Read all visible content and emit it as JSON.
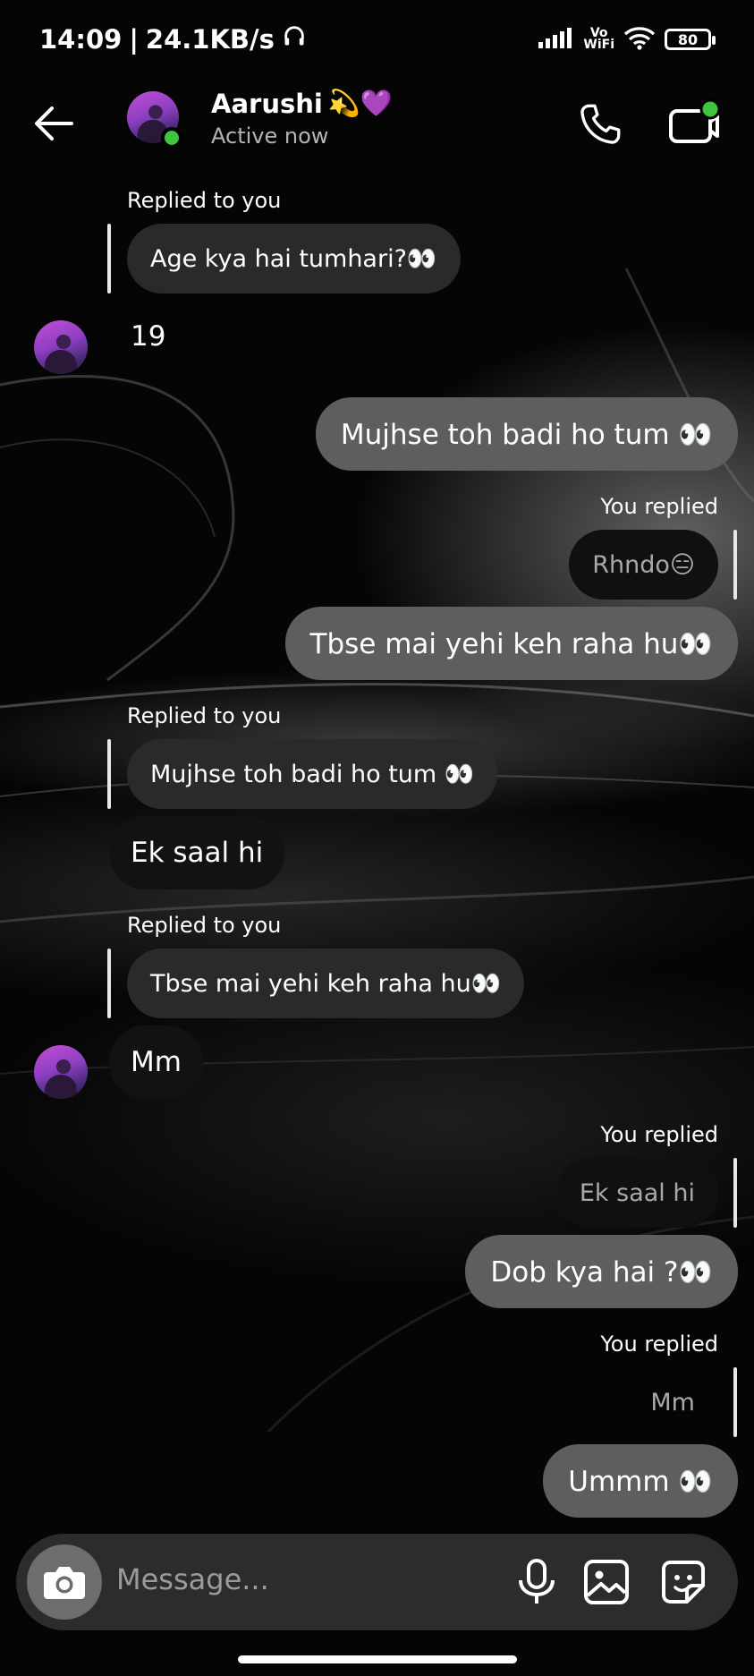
{
  "status_bar": {
    "time": "14:09",
    "network_speed": "24.1KB/s",
    "vowifi_line1": "Vo",
    "vowifi_line2": "WiFi",
    "battery": "80"
  },
  "header": {
    "name": "Aarushi",
    "emoji": "💫💜",
    "status": "Active now",
    "online_indicator_color": "#3ec43e"
  },
  "messages": [
    {
      "kind": "incoming_reply",
      "label": "Replied to you",
      "quoted": "Age kya hai tumhari?👀"
    },
    {
      "kind": "incoming",
      "text": "19"
    },
    {
      "kind": "outgoing",
      "text": "Mujhse toh badi ho tum 👀"
    },
    {
      "kind": "outgoing_reply",
      "label": "You replied",
      "quoted": "Rhndo😑",
      "text": "Tbse mai yehi keh raha hu👀"
    },
    {
      "kind": "incoming_reply",
      "label": "Replied to you",
      "quoted": "Mujhse toh badi ho tum 👀",
      "text": "Ek saal hi"
    },
    {
      "kind": "incoming_reply",
      "label": "Replied to you",
      "quoted": "Tbse mai yehi keh raha hu👀"
    },
    {
      "kind": "incoming",
      "text": "Mm"
    },
    {
      "kind": "outgoing_reply",
      "label": "You replied",
      "quoted": "Ek saal hi",
      "text": "Dob kya hai ?👀"
    },
    {
      "kind": "outgoing_reply",
      "label": "You replied",
      "quoted": "Mm",
      "text": "Ummm 👀"
    }
  ],
  "composer": {
    "placeholder": "Message..."
  },
  "colors": {
    "outgoing_bubble": "#5e5e5e",
    "incoming_bubble": "#121212",
    "quoted_bubble": "#2a2a2a",
    "composer_bg": "#2c2c2c"
  }
}
